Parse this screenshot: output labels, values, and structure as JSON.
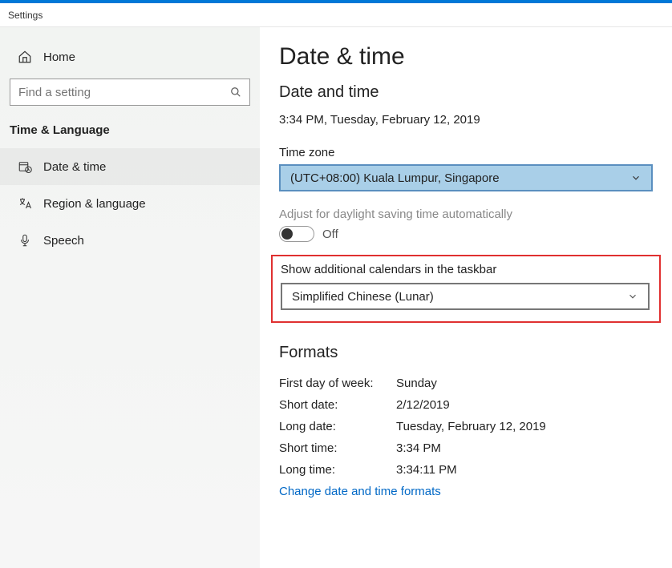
{
  "window": {
    "title": "Settings"
  },
  "sidebar": {
    "home": "Home",
    "search_placeholder": "Find a setting",
    "category": "Time & Language",
    "items": [
      {
        "label": "Date & time"
      },
      {
        "label": "Region & language"
      },
      {
        "label": "Speech"
      }
    ]
  },
  "page": {
    "title": "Date & time",
    "section_datetime": "Date and time",
    "now": "3:34 PM, Tuesday, February 12, 2019",
    "timezone_label": "Time zone",
    "timezone_value": "(UTC+08:00) Kuala Lumpur, Singapore",
    "dst_label": "Adjust for daylight saving time automatically",
    "dst_state": "Off",
    "addcal_label": "Show additional calendars in the taskbar",
    "addcal_value": "Simplified Chinese (Lunar)",
    "formats_title": "Formats",
    "formats": {
      "firstday_k": "First day of week:",
      "firstday_v": "Sunday",
      "shortdate_k": "Short date:",
      "shortdate_v": "2/12/2019",
      "longdate_k": "Long date:",
      "longdate_v": "Tuesday, February 12, 2019",
      "shorttime_k": "Short time:",
      "shorttime_v": "3:34 PM",
      "longtime_k": "Long time:",
      "longtime_v": "3:34:11 PM"
    },
    "change_formats_link": "Change date and time formats"
  }
}
